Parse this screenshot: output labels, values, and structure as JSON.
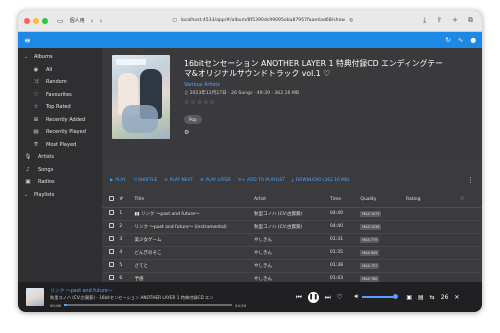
{
  "browser": {
    "profile": "個人用",
    "url": "localhost:4533/app/#/album/8f5390dc99095eba87957faae4ad68/show"
  },
  "sidebar": {
    "albums_label": "Albums",
    "items": [
      {
        "label": "All",
        "icon": "radio-icon"
      },
      {
        "label": "Random",
        "icon": "shuffle-icon"
      },
      {
        "label": "Favourites",
        "icon": "heart-icon"
      },
      {
        "label": "Top Rated",
        "icon": "star-icon"
      },
      {
        "label": "Recently Added",
        "icon": "library-add-icon"
      },
      {
        "label": "Recently Played",
        "icon": "library-music-icon"
      },
      {
        "label": "Most Played",
        "icon": "most-played-icon"
      }
    ],
    "sections": [
      {
        "label": "Artists",
        "icon": "mic-icon"
      },
      {
        "label": "Songs",
        "icon": "music-note-icon"
      },
      {
        "label": "Radios",
        "icon": "radio-box-icon"
      }
    ],
    "playlists_label": "Playlists"
  },
  "album": {
    "title": "16bitセンセーション ANOTHER LAYER 1 特典付録CD エンディングテーマ&オリジナルサウンドトラック vol.1 ♡",
    "artist": "Various Artists",
    "meta": "♫ 2023年12月27日 · 26 Songs · 49:30 · 362.16 MB",
    "stars": "☆☆☆☆☆",
    "genre": "Pop"
  },
  "toolbar": {
    "play": "PLAY",
    "shuffle": "SHUFFLE",
    "play_next": "PLAY NEXT",
    "play_later": "PLAY LATER",
    "add_to_playlist": "ADD TO PLAYLIST",
    "download": "DOWNLOAD (362.16 MB)"
  },
  "table": {
    "headers": {
      "num": "#",
      "title": "Title",
      "artist": "Artist",
      "time": "Time",
      "quality": "Quality",
      "rating": "Rating"
    },
    "rows": [
      {
        "num": "1",
        "title": "リンク ～past and future～",
        "artist": "秋里コノハ (CV:古賀葵)",
        "time": "04:40",
        "quality": "M4A 1073"
      },
      {
        "num": "2",
        "title": "リンク ～past and future～ (instrumental)",
        "artist": "秋里コノハ (CV:古賀葵)",
        "time": "04:40",
        "quality": "M4A 1036"
      },
      {
        "num": "3",
        "title": "美少女ゲーム",
        "artist": "やしきん",
        "time": "01:31",
        "quality": "M4A 775"
      },
      {
        "num": "4",
        "title": "どんぎのそこ",
        "artist": "やしきん",
        "time": "01:35",
        "quality": "M4A 849"
      },
      {
        "num": "5",
        "title": "さてと",
        "artist": "やしきん",
        "time": "01:38",
        "quality": "M4A 757"
      },
      {
        "num": "6",
        "title": "予感",
        "artist": "やしきん",
        "time": "01:43",
        "quality": "M4A 780"
      }
    ]
  },
  "player": {
    "title": "リンク ～past and future～",
    "meta": "秋里コノハ (CV:古賀葵) - 16bitセンセーション ANOTHER LAYER 1 特典付録CD エン",
    "elapsed": "00:06",
    "total": "04:39",
    "progress_fraction": 0.02,
    "queue_count": "26"
  },
  "colors": {
    "accent": "#1e88e5",
    "link": "#58a6ff"
  }
}
